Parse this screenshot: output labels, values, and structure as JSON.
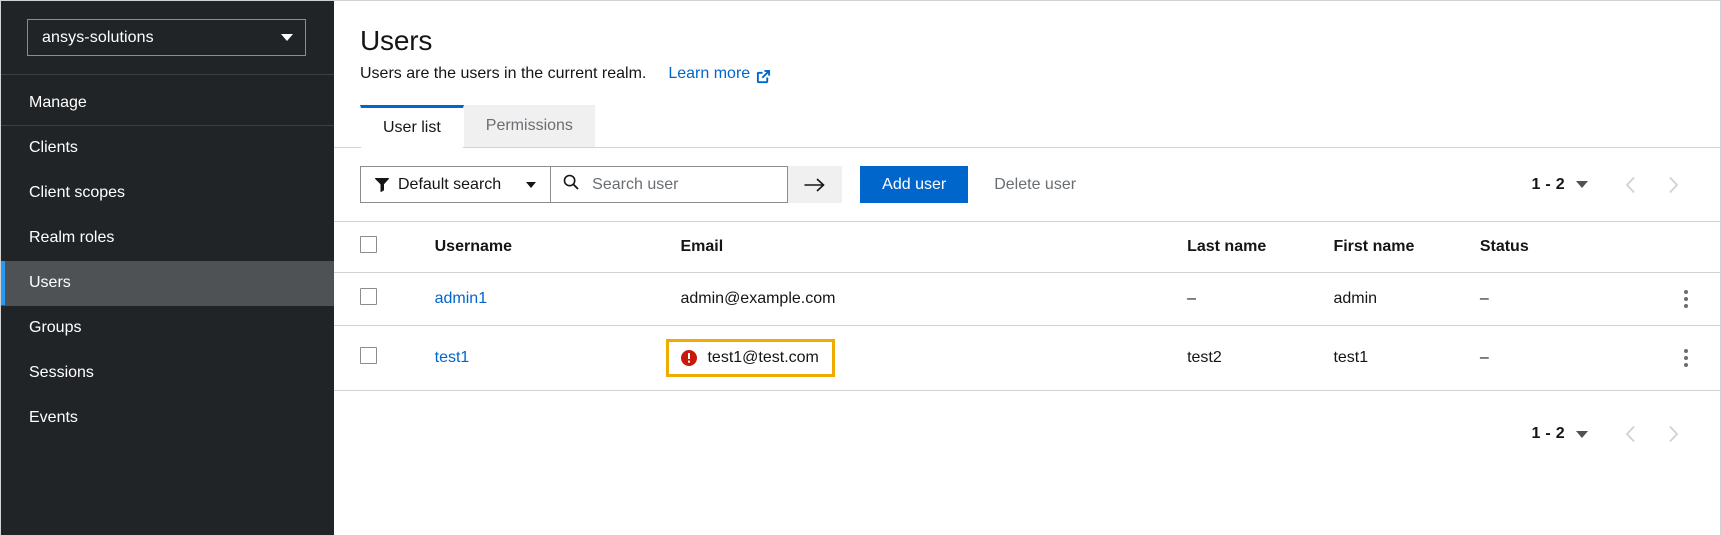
{
  "sidebar": {
    "realm_selector": {
      "value": "ansys-solutions",
      "caret_icon": "chevron-down-icon"
    },
    "items": [
      {
        "label": "Manage",
        "active": false,
        "section": true
      },
      {
        "label": "Clients",
        "active": false,
        "section": false
      },
      {
        "label": "Client scopes",
        "active": false,
        "section": false
      },
      {
        "label": "Realm roles",
        "active": false,
        "section": false
      },
      {
        "label": "Users",
        "active": true,
        "section": false
      },
      {
        "label": "Groups",
        "active": false,
        "section": false
      },
      {
        "label": "Sessions",
        "active": false,
        "section": false
      },
      {
        "label": "Events",
        "active": false,
        "section": false
      }
    ]
  },
  "page": {
    "title": "Users",
    "subtitle": "Users are the users in the current realm.",
    "learn_more": "Learn more",
    "learn_more_icon": "external-link-icon"
  },
  "tabs": [
    {
      "label": "User list",
      "active": true
    },
    {
      "label": "Permissions",
      "active": false
    }
  ],
  "toolbar": {
    "filter": {
      "label": "Default search",
      "icon": "filter-icon",
      "caret_icon": "chevron-down-icon"
    },
    "search": {
      "placeholder": "Search user",
      "value": "",
      "icon": "search-icon",
      "submit_icon": "arrow-right-icon"
    },
    "add_user_label": "Add user",
    "delete_user_label": "Delete user"
  },
  "pagination_top": {
    "range": "1 - 2",
    "caret_icon": "chevron-down-icon",
    "prev_icon": "chevron-left-icon",
    "next_icon": "chevron-right-icon"
  },
  "pagination_bottom": {
    "range": "1 - 2",
    "caret_icon": "chevron-down-icon",
    "prev_icon": "chevron-left-icon",
    "next_icon": "chevron-right-icon"
  },
  "table": {
    "columns": [
      "Username",
      "Email",
      "Last name",
      "First name",
      "Status"
    ],
    "rows": [
      {
        "username": "admin1",
        "email": "admin@example.com",
        "email_error": false,
        "last_name": "–",
        "first_name": "admin",
        "status": "–",
        "kebab_icon": "kebab-menu-icon"
      },
      {
        "username": "test1",
        "email": "test1@test.com",
        "email_error": true,
        "email_error_icon": "error-circle-icon",
        "last_name": "test2",
        "first_name": "test1",
        "status": "–",
        "kebab_icon": "kebab-menu-icon"
      }
    ]
  },
  "colors": {
    "accent_blue": "#0066cc",
    "sidebar_bg": "#212427",
    "sidebar_active": "#4f5255",
    "active_marker": "#2b9af3",
    "highlight_border": "#f0ab00",
    "error_red": "#c9190b"
  }
}
